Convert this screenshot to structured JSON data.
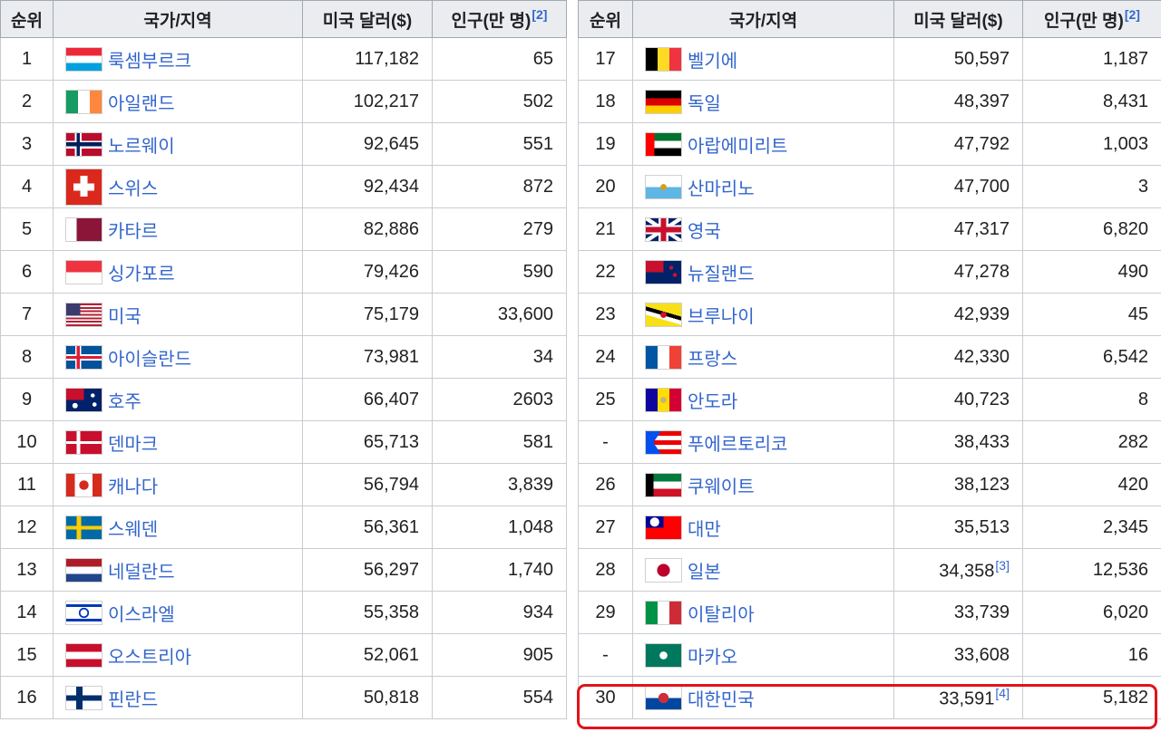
{
  "headers": {
    "rank": "순위",
    "country": "국가/지역",
    "usd": "미국 달러($)",
    "population_left": "인구(만 명)",
    "population_right": "인구(만 명)",
    "header_ref": "[2]"
  },
  "left_rows": [
    {
      "rank": "1",
      "country": "룩셈부르크",
      "flag": "lu",
      "usd": "117,182",
      "pop": "65"
    },
    {
      "rank": "2",
      "country": "아일랜드",
      "flag": "ie",
      "usd": "102,217",
      "pop": "502"
    },
    {
      "rank": "3",
      "country": "노르웨이",
      "flag": "no",
      "usd": "92,645",
      "pop": "551"
    },
    {
      "rank": "4",
      "country": "스위스",
      "flag": "ch",
      "usd": "92,434",
      "pop": "872"
    },
    {
      "rank": "5",
      "country": "카타르",
      "flag": "qa",
      "usd": "82,886",
      "pop": "279"
    },
    {
      "rank": "6",
      "country": "싱가포르",
      "flag": "sg",
      "usd": "79,426",
      "pop": "590"
    },
    {
      "rank": "7",
      "country": "미국",
      "flag": "us",
      "usd": "75,179",
      "pop": "33,600"
    },
    {
      "rank": "8",
      "country": "아이슬란드",
      "flag": "is",
      "usd": "73,981",
      "pop": "34"
    },
    {
      "rank": "9",
      "country": "호주",
      "flag": "au",
      "usd": "66,407",
      "pop": "2603"
    },
    {
      "rank": "10",
      "country": "덴마크",
      "flag": "dk",
      "usd": "65,713",
      "pop": "581"
    },
    {
      "rank": "11",
      "country": "캐나다",
      "flag": "ca",
      "usd": "56,794",
      "pop": "3,839"
    },
    {
      "rank": "12",
      "country": "스웨덴",
      "flag": "se",
      "usd": "56,361",
      "pop": "1,048"
    },
    {
      "rank": "13",
      "country": "네덜란드",
      "flag": "nl",
      "usd": "56,297",
      "pop": "1,740"
    },
    {
      "rank": "14",
      "country": "이스라엘",
      "flag": "il",
      "usd": "55,358",
      "pop": "934"
    },
    {
      "rank": "15",
      "country": "오스트리아",
      "flag": "at",
      "usd": "52,061",
      "pop": "905"
    },
    {
      "rank": "16",
      "country": "핀란드",
      "flag": "fi",
      "usd": "50,818",
      "pop": "554"
    }
  ],
  "right_rows": [
    {
      "rank": "17",
      "country": "벨기에",
      "flag": "be",
      "usd": "50,597",
      "pop": "1,187"
    },
    {
      "rank": "18",
      "country": "독일",
      "flag": "de",
      "usd": "48,397",
      "pop": "8,431"
    },
    {
      "rank": "19",
      "country": "아랍에미리트",
      "flag": "ae",
      "usd": "47,792",
      "pop": "1,003"
    },
    {
      "rank": "20",
      "country": "산마리노",
      "flag": "sm",
      "usd": "47,700",
      "pop": "3"
    },
    {
      "rank": "21",
      "country": "영국",
      "flag": "gb",
      "usd": "47,317",
      "pop": "6,820"
    },
    {
      "rank": "22",
      "country": "뉴질랜드",
      "flag": "nz",
      "usd": "47,278",
      "pop": "490"
    },
    {
      "rank": "23",
      "country": "브루나이",
      "flag": "bn",
      "usd": "42,939",
      "pop": "45"
    },
    {
      "rank": "24",
      "country": "프랑스",
      "flag": "fr",
      "usd": "42,330",
      "pop": "6,542"
    },
    {
      "rank": "25",
      "country": "안도라",
      "flag": "ad",
      "usd": "40,723",
      "pop": "8"
    },
    {
      "rank": "-",
      "country": "푸에르토리코",
      "flag": "pr",
      "usd": "38,433",
      "pop": "282"
    },
    {
      "rank": "26",
      "country": "쿠웨이트",
      "flag": "kw",
      "usd": "38,123",
      "pop": "420"
    },
    {
      "rank": "27",
      "country": "대만",
      "flag": "tw",
      "usd": "35,513",
      "pop": "2,345"
    },
    {
      "rank": "28",
      "country": "일본",
      "flag": "jp",
      "usd": "34,358",
      "usd_ref": "[3]",
      "pop": "12,536"
    },
    {
      "rank": "29",
      "country": "이탈리아",
      "flag": "it",
      "usd": "33,739",
      "pop": "6,020"
    },
    {
      "rank": "-",
      "country": "마카오",
      "flag": "mo",
      "usd": "33,608",
      "pop": "16"
    },
    {
      "rank": "30",
      "country": "대한민국",
      "flag": "kr",
      "usd": "33,591",
      "usd_ref": "[4]",
      "pop": "5,182",
      "highlighted": true
    }
  ],
  "colors": {
    "header_bg": "#eaecf0",
    "link": "#3366cc",
    "highlight_border": "#e0141a"
  }
}
